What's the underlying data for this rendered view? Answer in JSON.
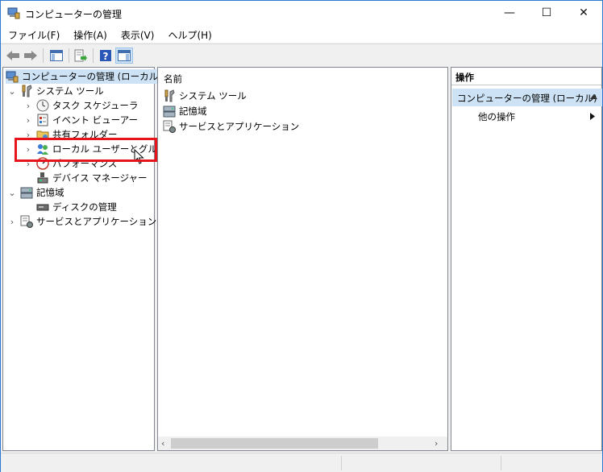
{
  "window": {
    "title": "コンピューターの管理"
  },
  "titlebar": {
    "min_glyph": "—",
    "max_glyph": "☐",
    "close_glyph": "✕"
  },
  "menu": [
    "ファイル(F)",
    "操作(A)",
    "表示(V)",
    "ヘルプ(H)"
  ],
  "toolbar": {
    "icons": [
      "back-arrow-icon",
      "forward-arrow-icon",
      "show-hide-console-tree-icon",
      "export-list-icon",
      "help-icon",
      "show-hide-action-pane-icon"
    ]
  },
  "tree": {
    "root": "コンピューターの管理 (ローカル)",
    "system_tools": "システム ツール",
    "task_scheduler": "タスク スケジューラ",
    "event_viewer": "イベント ビューアー",
    "shared_folders": "共有フォルダー",
    "local_users": "ローカル ユーザーとグループ",
    "performance": "パフォーマンス",
    "device_manager": "デバイス マネージャー",
    "storage": "記憶域",
    "disk_management": "ディスクの管理",
    "services_apps": "サービスとアプリケーション"
  },
  "list": {
    "header": "名前",
    "items": [
      "システム ツール",
      "記憶域",
      "サービスとアプリケーション"
    ]
  },
  "actions": {
    "title": "操作",
    "selected": "コンピューターの管理 (ローカル)",
    "more": "他の操作"
  },
  "colors": {
    "highlight": "#cde3f5",
    "annotation_box": "#e8141b",
    "window_border": "#2b79d0"
  }
}
